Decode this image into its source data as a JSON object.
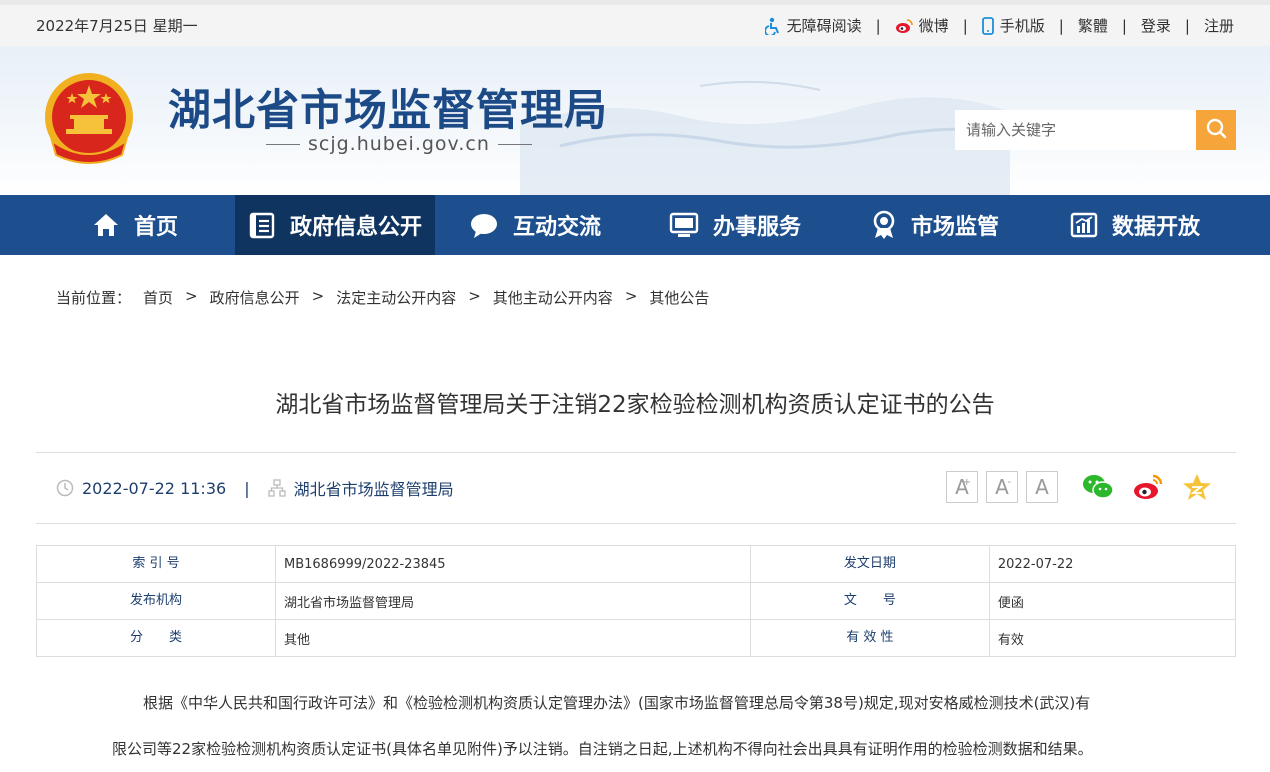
{
  "topbar": {
    "date": "2022年7月25日 星期一",
    "links": [
      {
        "label": "无障碍阅读",
        "icon": "accessibility-icon"
      },
      {
        "label": "微博",
        "icon": "weibo-icon"
      },
      {
        "label": "手机版",
        "icon": "mobile-icon"
      },
      {
        "label": "繁體",
        "icon": ""
      },
      {
        "label": "登录",
        "icon": ""
      },
      {
        "label": "注册",
        "icon": ""
      }
    ]
  },
  "header": {
    "title": "湖北省市场监督管理局",
    "domain": "scjg.hubei.gov.cn",
    "search_placeholder": "请输入关键字"
  },
  "nav": {
    "items": [
      {
        "label": "首页",
        "icon": "home-icon"
      },
      {
        "label": "政府信息公开",
        "icon": "document-icon"
      },
      {
        "label": "互动交流",
        "icon": "chat-icon"
      },
      {
        "label": "办事服务",
        "icon": "monitor-icon"
      },
      {
        "label": "市场监管",
        "icon": "badge-icon"
      },
      {
        "label": "数据开放",
        "icon": "chart-icon"
      }
    ],
    "active_index": 1
  },
  "breadcrumb": {
    "prefix": "当前位置：",
    "items": [
      "首页",
      "政府信息公开",
      "法定主动公开内容",
      "其他主动公开内容",
      "其他公告"
    ],
    "separator": ">"
  },
  "article": {
    "title": "湖北省市场监督管理局关于注销22家检验检测机构资质认定证书的公告",
    "datetime": "2022-07-22 11:36",
    "meta_separator": "|",
    "source": "湖北省市场监督管理局",
    "font_buttons": [
      "A",
      "A",
      "A"
    ],
    "font_button_marks": [
      "+",
      "-",
      ""
    ]
  },
  "info_table": {
    "rows": [
      {
        "k1": "索 引 号",
        "v1": "MB1686999/2022-23845",
        "k2": "发文日期",
        "v2": "2022-07-22"
      },
      {
        "k1": "发布机构",
        "v1": "湖北省市场监督管理局",
        "k2": "文　　号",
        "v2": "便函"
      },
      {
        "k1": "分　　类",
        "v1": "其他",
        "k2": "有 效 性",
        "v2": "有效"
      }
    ]
  },
  "body": {
    "line1": "根据《中华人民共和国行政许可法》和《检验检测机构资质认定管理办法》(国家市场监督管理总局令第38号)规定,现对安格威检测技术(武汉)有",
    "line2": "限公司等22家检验检测机构资质认定证书(具体名单见附件)予以注销。自注销之日起,上述机构不得向社会出具具有证明作用的检验检测数据和结果。"
  },
  "colors": {
    "nav_bg": "#1d4f8e",
    "nav_active": "#0f3460",
    "title_blue": "#1c4a86",
    "search_btn": "#f6a53a"
  }
}
